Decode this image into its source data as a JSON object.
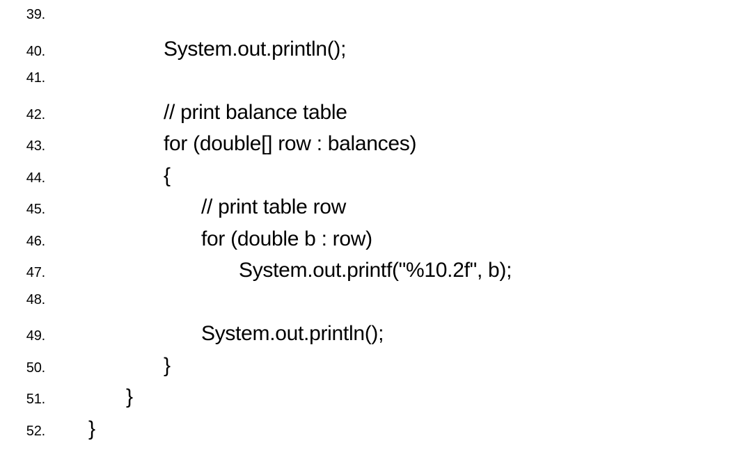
{
  "lines": [
    {
      "n": "39.",
      "indent": 0,
      "text": ""
    },
    {
      "n": "40.",
      "indent": 9,
      "text": "System.out.println();"
    },
    {
      "n": "41.",
      "indent": 0,
      "text": ""
    },
    {
      "n": "42.",
      "indent": 9,
      "text": "// print balance table"
    },
    {
      "n": "43.",
      "indent": 9,
      "text": "for (double[] row : balances)"
    },
    {
      "n": "44.",
      "indent": 9,
      "text": "{"
    },
    {
      "n": "45.",
      "indent": 12,
      "text": "// print table row"
    },
    {
      "n": "46.",
      "indent": 12,
      "text": "for (double b : row)"
    },
    {
      "n": "47.",
      "indent": 15,
      "text": "System.out.printf(\"%10.2f\", b);"
    },
    {
      "n": "48.",
      "indent": 0,
      "text": ""
    },
    {
      "n": "49.",
      "indent": 12,
      "text": "System.out.println();"
    },
    {
      "n": "50.",
      "indent": 9,
      "text": "}"
    },
    {
      "n": "51.",
      "indent": 6,
      "text": "}"
    },
    {
      "n": "52.",
      "indent": 3,
      "text": "}"
    }
  ]
}
